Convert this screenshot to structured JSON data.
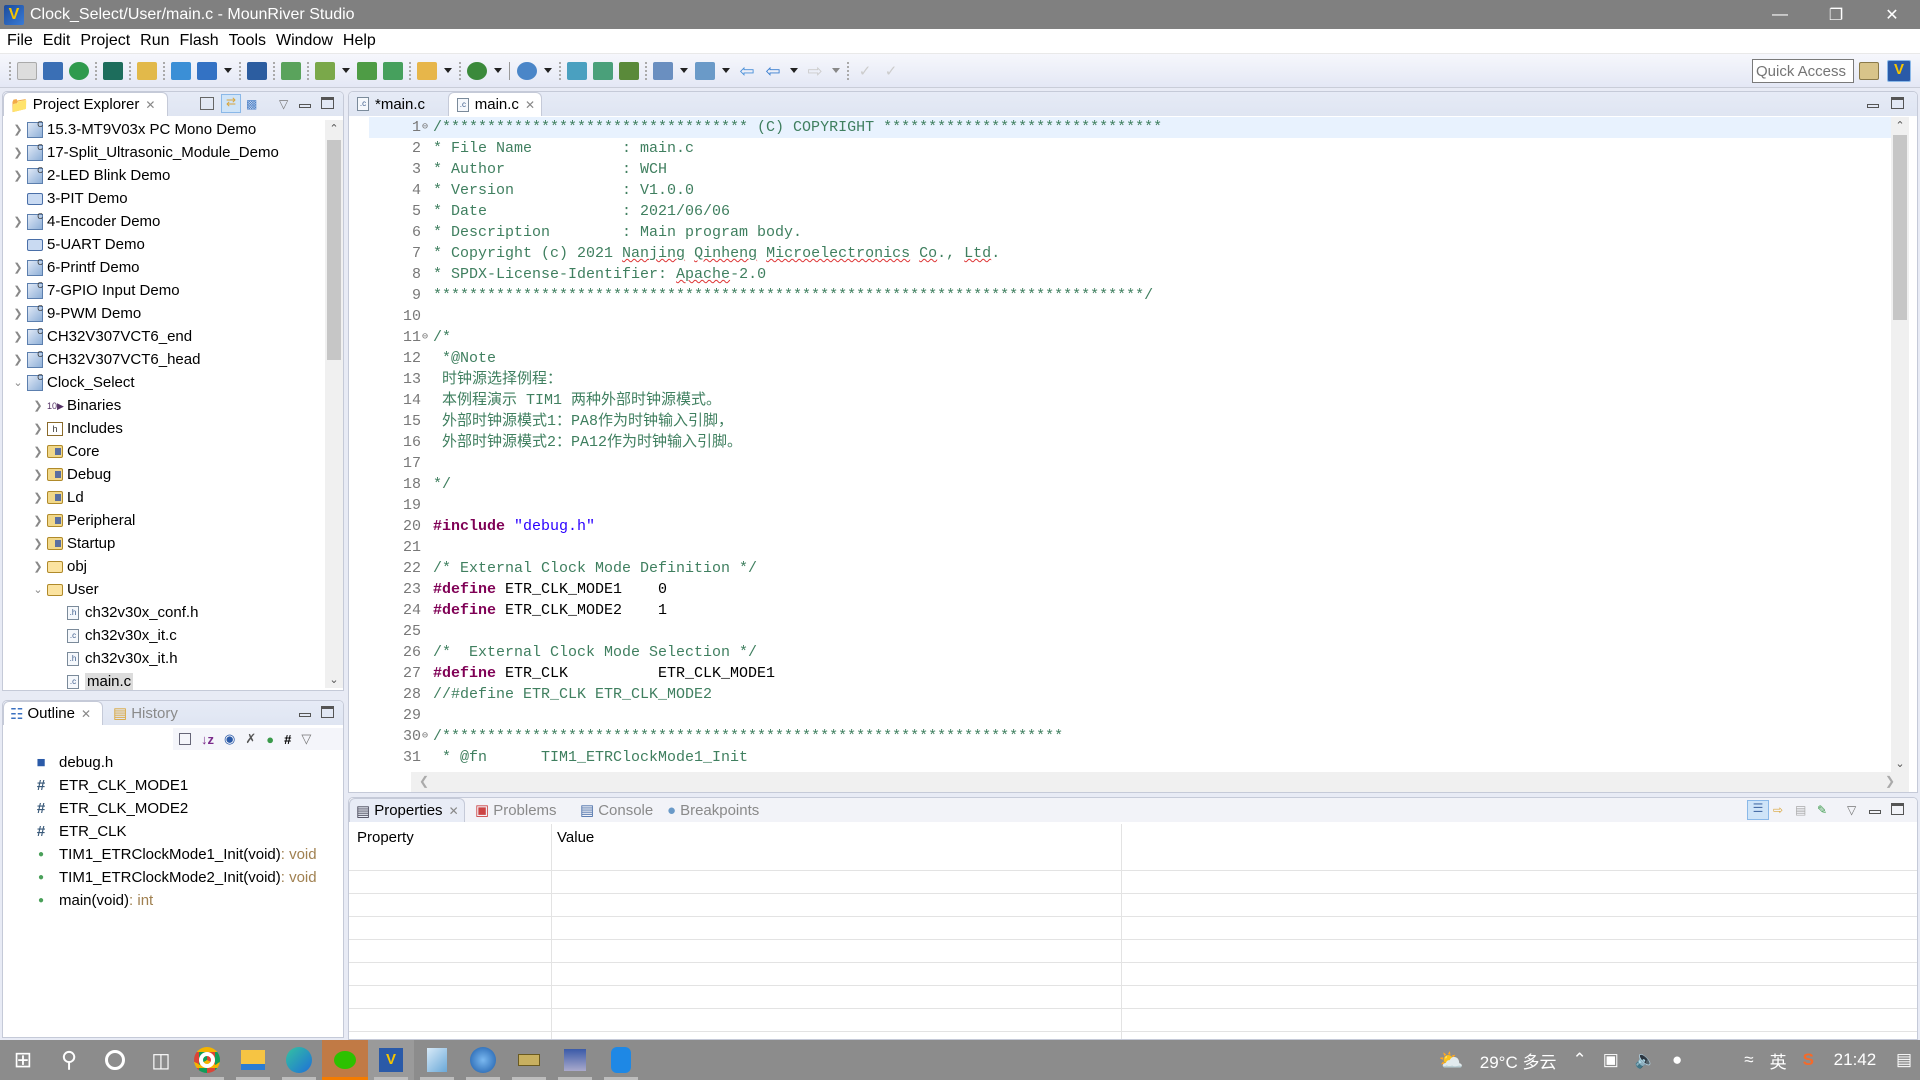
{
  "window": {
    "title": "Clock_Select/User/main.c - MounRiver Studio",
    "controls": [
      "minimize",
      "restore",
      "close"
    ]
  },
  "menu": [
    "File",
    "Edit",
    "Project",
    "Run",
    "Flash",
    "Tools",
    "Window",
    "Help"
  ],
  "toolbar": {
    "quick_access_placeholder": "Quick Access"
  },
  "project_explorer": {
    "title": "Project Explorer",
    "items": [
      {
        "label": "15.3-MT9V03x PC Mono Demo",
        "type": "project",
        "level": 0,
        "expand": "collapsed"
      },
      {
        "label": "17-Split_Ultrasonic_Module_Demo",
        "type": "project",
        "level": 0,
        "expand": "collapsed"
      },
      {
        "label": "2-LED Blink Demo",
        "type": "project",
        "level": 0,
        "expand": "collapsed"
      },
      {
        "label": "3-PIT Demo",
        "type": "closed-project",
        "level": 0,
        "expand": "none"
      },
      {
        "label": "4-Encoder Demo",
        "type": "project",
        "level": 0,
        "expand": "collapsed"
      },
      {
        "label": "5-UART Demo",
        "type": "closed-project",
        "level": 0,
        "expand": "none"
      },
      {
        "label": "6-Printf Demo",
        "type": "project",
        "level": 0,
        "expand": "collapsed"
      },
      {
        "label": "7-GPIO Input Demo",
        "type": "project",
        "level": 0,
        "expand": "collapsed"
      },
      {
        "label": "9-PWM Demo",
        "type": "project",
        "level": 0,
        "expand": "collapsed"
      },
      {
        "label": "CH32V307VCT6_end",
        "type": "project-warning",
        "level": 0,
        "expand": "collapsed"
      },
      {
        "label": "CH32V307VCT6_head",
        "type": "project-warning",
        "level": 0,
        "expand": "collapsed"
      },
      {
        "label": "Clock_Select",
        "type": "project",
        "level": 0,
        "expand": "expanded"
      },
      {
        "label": "Binaries",
        "type": "binaries",
        "level": 1,
        "expand": "collapsed"
      },
      {
        "label": "Includes",
        "type": "includes",
        "level": 1,
        "expand": "collapsed"
      },
      {
        "label": "Core",
        "type": "source-folder",
        "level": 1,
        "expand": "collapsed"
      },
      {
        "label": "Debug",
        "type": "source-folder",
        "level": 1,
        "expand": "collapsed"
      },
      {
        "label": "Ld",
        "type": "source-folder",
        "level": 1,
        "expand": "collapsed"
      },
      {
        "label": "Peripheral",
        "type": "source-folder",
        "level": 1,
        "expand": "collapsed"
      },
      {
        "label": "Startup",
        "type": "source-folder",
        "level": 1,
        "expand": "collapsed"
      },
      {
        "label": "obj",
        "type": "folder",
        "level": 1,
        "expand": "collapsed"
      },
      {
        "label": "User",
        "type": "folder",
        "level": 1,
        "expand": "expanded"
      },
      {
        "label": "ch32v30x_conf.h",
        "type": "h-file",
        "level": 2,
        "expand": "none"
      },
      {
        "label": "ch32v30x_it.c",
        "type": "c-file",
        "level": 2,
        "expand": "none"
      },
      {
        "label": "ch32v30x_it.h",
        "type": "h-file",
        "level": 2,
        "expand": "none"
      },
      {
        "label": "main.c",
        "type": "c-file",
        "level": 2,
        "expand": "none",
        "selected": true
      }
    ]
  },
  "outline": {
    "title": "Outline",
    "history_tab": "History",
    "items": [
      {
        "label": "debug.h",
        "kind": "include",
        "type": ""
      },
      {
        "label": "ETR_CLK_MODE1",
        "kind": "macro",
        "type": ""
      },
      {
        "label": "ETR_CLK_MODE2",
        "kind": "macro",
        "type": ""
      },
      {
        "label": "ETR_CLK",
        "kind": "macro",
        "type": ""
      },
      {
        "label": "TIM1_ETRClockMode1_Init(void)",
        "kind": "function",
        "type": " : void"
      },
      {
        "label": "TIM1_ETRClockMode2_Init(void)",
        "kind": "function",
        "type": " : void"
      },
      {
        "label": "main(void)",
        "kind": "function",
        "type": " : int"
      }
    ]
  },
  "editor": {
    "tabs": [
      {
        "label": "*main.c",
        "active": false
      },
      {
        "label": "main.c",
        "active": true
      }
    ],
    "lines": [
      {
        "n": "1",
        "fold": true,
        "hl": true,
        "parts": [
          {
            "c": "cm",
            "t": "/********************************** (C) COPYRIGHT *******************************"
          }
        ]
      },
      {
        "n": "2",
        "parts": [
          {
            "c": "cm",
            "t": "* File Name          : main.c"
          }
        ]
      },
      {
        "n": "3",
        "parts": [
          {
            "c": "cm",
            "t": "* Author             : WCH"
          }
        ]
      },
      {
        "n": "4",
        "parts": [
          {
            "c": "cm",
            "t": "* Version            : V1.0.0"
          }
        ]
      },
      {
        "n": "5",
        "parts": [
          {
            "c": "cm",
            "t": "* Date               : 2021/06/06"
          }
        ]
      },
      {
        "n": "6",
        "parts": [
          {
            "c": "cm",
            "t": "* Description        : Main program body."
          }
        ]
      },
      {
        "n": "7",
        "parts": [
          {
            "c": "cm",
            "t": "* Copyright (c) 2021 "
          },
          {
            "c": "cm sq",
            "t": "Nanjing"
          },
          {
            "c": "cm",
            "t": " "
          },
          {
            "c": "cm sq",
            "t": "Qinheng"
          },
          {
            "c": "cm",
            "t": " "
          },
          {
            "c": "cm sq",
            "t": "Microelectronics"
          },
          {
            "c": "cm",
            "t": " "
          },
          {
            "c": "cm sq",
            "t": "Co"
          },
          {
            "c": "cm",
            "t": "., "
          },
          {
            "c": "cm sq",
            "t": "Ltd"
          },
          {
            "c": "cm",
            "t": "."
          }
        ]
      },
      {
        "n": "8",
        "parts": [
          {
            "c": "cm",
            "t": "* SPDX-License-Identifier: "
          },
          {
            "c": "cm sq",
            "t": "Apache"
          },
          {
            "c": "cm",
            "t": "-2.0"
          }
        ]
      },
      {
        "n": "9",
        "parts": [
          {
            "c": "cm",
            "t": "*******************************************************************************/"
          }
        ]
      },
      {
        "n": "10",
        "parts": []
      },
      {
        "n": "11",
        "fold": true,
        "parts": [
          {
            "c": "cm",
            "t": "/*"
          }
        ]
      },
      {
        "n": "12",
        "parts": [
          {
            "c": "cm",
            "t": " *@Note"
          }
        ]
      },
      {
        "n": "13",
        "parts": [
          {
            "c": "cm",
            "t": " 时钟源选择例程："
          }
        ]
      },
      {
        "n": "14",
        "parts": [
          {
            "c": "cm",
            "t": " 本例程演示 TIM1 两种外部时钟源模式。"
          }
        ]
      },
      {
        "n": "15",
        "parts": [
          {
            "c": "cm",
            "t": " 外部时钟源模式1：PA8作为时钟输入引脚，"
          }
        ]
      },
      {
        "n": "16",
        "parts": [
          {
            "c": "cm",
            "t": " 外部时钟源模式2：PA12作为时钟输入引脚。"
          }
        ]
      },
      {
        "n": "17",
        "parts": []
      },
      {
        "n": "18",
        "parts": [
          {
            "c": "cm",
            "t": "*/"
          }
        ]
      },
      {
        "n": "19",
        "parts": []
      },
      {
        "n": "20",
        "parts": [
          {
            "c": "kw",
            "t": "#include"
          },
          {
            "c": "pl",
            "t": " "
          },
          {
            "c": "st",
            "t": "\"debug.h\""
          }
        ]
      },
      {
        "n": "21",
        "parts": []
      },
      {
        "n": "22",
        "parts": [
          {
            "c": "cm",
            "t": "/* External Clock Mode Definition */"
          }
        ]
      },
      {
        "n": "23",
        "parts": [
          {
            "c": "kw",
            "t": "#define"
          },
          {
            "c": "pl",
            "t": " ETR_CLK_MODE1    0"
          }
        ]
      },
      {
        "n": "24",
        "parts": [
          {
            "c": "kw",
            "t": "#define"
          },
          {
            "c": "pl",
            "t": " ETR_CLK_MODE2    1"
          }
        ]
      },
      {
        "n": "25",
        "parts": []
      },
      {
        "n": "26",
        "parts": [
          {
            "c": "cm",
            "t": "/*  External Clock Mode Selection */"
          }
        ]
      },
      {
        "n": "27",
        "parts": [
          {
            "c": "kw",
            "t": "#define"
          },
          {
            "c": "pl",
            "t": " ETR_CLK          ETR_CLK_MODE1"
          }
        ]
      },
      {
        "n": "28",
        "parts": [
          {
            "c": "cm",
            "t": "//#define ETR_CLK ETR_CLK_MODE2"
          }
        ]
      },
      {
        "n": "29",
        "parts": []
      },
      {
        "n": "30",
        "fold": true,
        "parts": [
          {
            "c": "cm",
            "t": "/*********************************************************************"
          }
        ]
      },
      {
        "n": "31",
        "parts": [
          {
            "c": "cm",
            "t": " * @fn      TIM1_ETRClockMode1_Init"
          }
        ]
      }
    ]
  },
  "bottom_panel": {
    "tabs": [
      {
        "label": "Properties",
        "active": true
      },
      {
        "label": "Problems",
        "active": false
      },
      {
        "label": "Console",
        "active": false
      },
      {
        "label": "Breakpoints",
        "active": false
      }
    ],
    "columns": [
      "Property",
      "Value"
    ]
  },
  "taskbar": {
    "apps": [
      "start",
      "search",
      "cortana",
      "task-view",
      "chrome",
      "file-explorer",
      "edge",
      "wechat",
      "mounriver",
      "notepad",
      "app-globe",
      "serial-tool",
      "network-tool",
      "phone-app"
    ],
    "weather": "29°C 多云",
    "ime": "英",
    "time": "21:42"
  },
  "colors": {
    "comment": "#3f7f5f",
    "keyword": "#7f0055",
    "string": "#2a00ff",
    "titlebar": "#808080",
    "taskbar": "#8c8c8c"
  }
}
